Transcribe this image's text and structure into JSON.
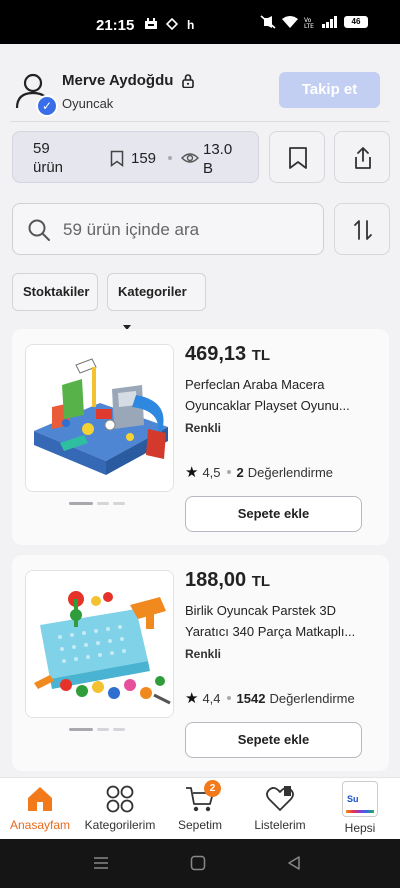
{
  "status_bar": {
    "time": "21:15",
    "notif_letter": "h",
    "battery": "46"
  },
  "store": {
    "name": "Merve Aydoğdu",
    "category": "Oyuncak",
    "follow_label": "Takip et"
  },
  "stats": {
    "product_count": "59 ürün",
    "favorites": "159",
    "views": "13.0 B"
  },
  "search": {
    "placeholder": "59 ürün içinde ara"
  },
  "filters": {
    "in_stock": "Stoktakiler",
    "categories": "Kategoriler"
  },
  "products": [
    {
      "price": "469,13",
      "currency": "TL",
      "title": "Perfeclan Araba Macera Oyuncaklar Playset Oyunu...",
      "variant": "Renkli",
      "rating": "4,5",
      "review_count": "2",
      "review_label": "Değerlendirme",
      "cart_label": "Sepete ekle"
    },
    {
      "price": "188,00",
      "currency": "TL",
      "title": "Birlik Oyuncak Parstek 3D Yaratıcı 340 Parça Matkaplı...",
      "variant": "Renkli",
      "rating": "4,4",
      "review_count": "1542",
      "review_label": "Değerlendirme",
      "cart_label": "Sepete ekle"
    }
  ],
  "bottom_nav": {
    "home": "Anasayfam",
    "categories": "Kategorilerim",
    "cart": "Sepetim",
    "cart_badge": "2",
    "lists": "Listelerim",
    "hepsi": "Hepsi",
    "hepsi_logo": "Su"
  },
  "colors": {
    "brand_orange": "#f27a1a",
    "follow_disabled": "#c3cef3",
    "verified_blue": "#3a6ee8"
  }
}
